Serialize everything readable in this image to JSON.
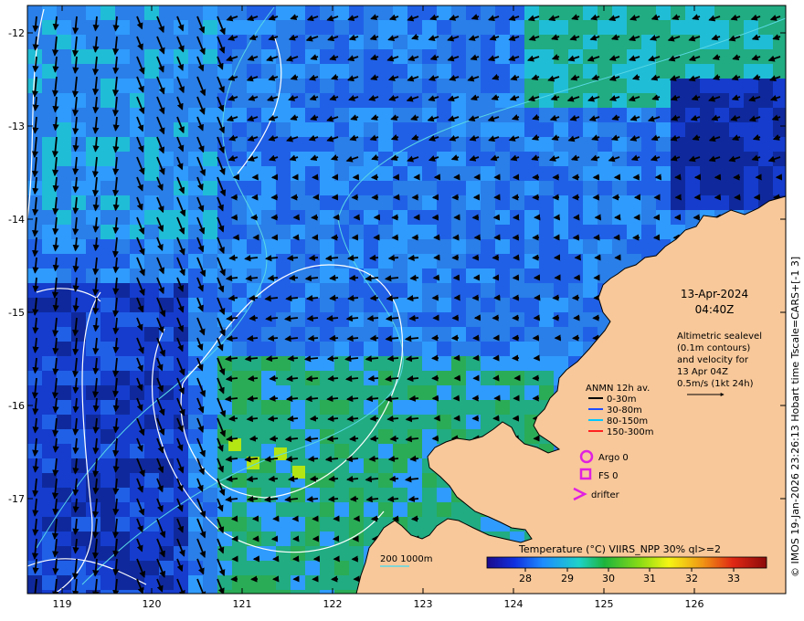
{
  "map": {
    "date": "13-Apr-2024",
    "time": "04:40Z",
    "altimetry_lines": [
      "Altimetric sealevel",
      "(0.1m contours)",
      "and velocity for",
      "13 Apr 04Z",
      "0.5m/s (1kt 24h)"
    ],
    "anmn": {
      "title": "ANMN 12h av.",
      "items": [
        {
          "label": "0-30m",
          "color": "#000000"
        },
        {
          "label": "30-80m",
          "color": "#1f4cff"
        },
        {
          "label": "80-150m",
          "color": "#00c8ff"
        },
        {
          "label": "150-300m",
          "color": "#ff2020"
        }
      ]
    },
    "symbols": [
      {
        "label": "Argo 0",
        "shape": "circle",
        "color": "#e020e0"
      },
      {
        "label": "FS 0",
        "shape": "square",
        "color": "#e020e0"
      },
      {
        "label": "drifter",
        "shape": "chevron",
        "color": "#e020e0"
      }
    ],
    "colorbar": {
      "title": "Temperature (°C) VIIRS_NPP 30% ql>=2",
      "ticks": [
        "28",
        "29",
        "30",
        "31",
        "32",
        "33"
      ],
      "stops": [
        "#1a0a8c",
        "#1030e0",
        "#1e8cff",
        "#1ed2c8",
        "#1eb43c",
        "#8cdc14",
        "#f5f514",
        "#f09614",
        "#e02814",
        "#8c0a0a"
      ]
    },
    "depth_legend": "200  1000m",
    "lat_ticks": [
      "-12",
      "-13",
      "-14",
      "-15",
      "-16",
      "-17"
    ],
    "lon_ticks": [
      "119",
      "120",
      "121",
      "122",
      "123",
      "124",
      "125",
      "126"
    ],
    "credit": "© IMOS 19-Jan-2026 23:26:13 Hobart time Tscale=CARS+[-1 3]",
    "colors": {
      "land": "#f8c89a",
      "sea_base": "#2a7fe8",
      "contour": "#ffffff",
      "bathy": "#5ad8e6"
    }
  }
}
